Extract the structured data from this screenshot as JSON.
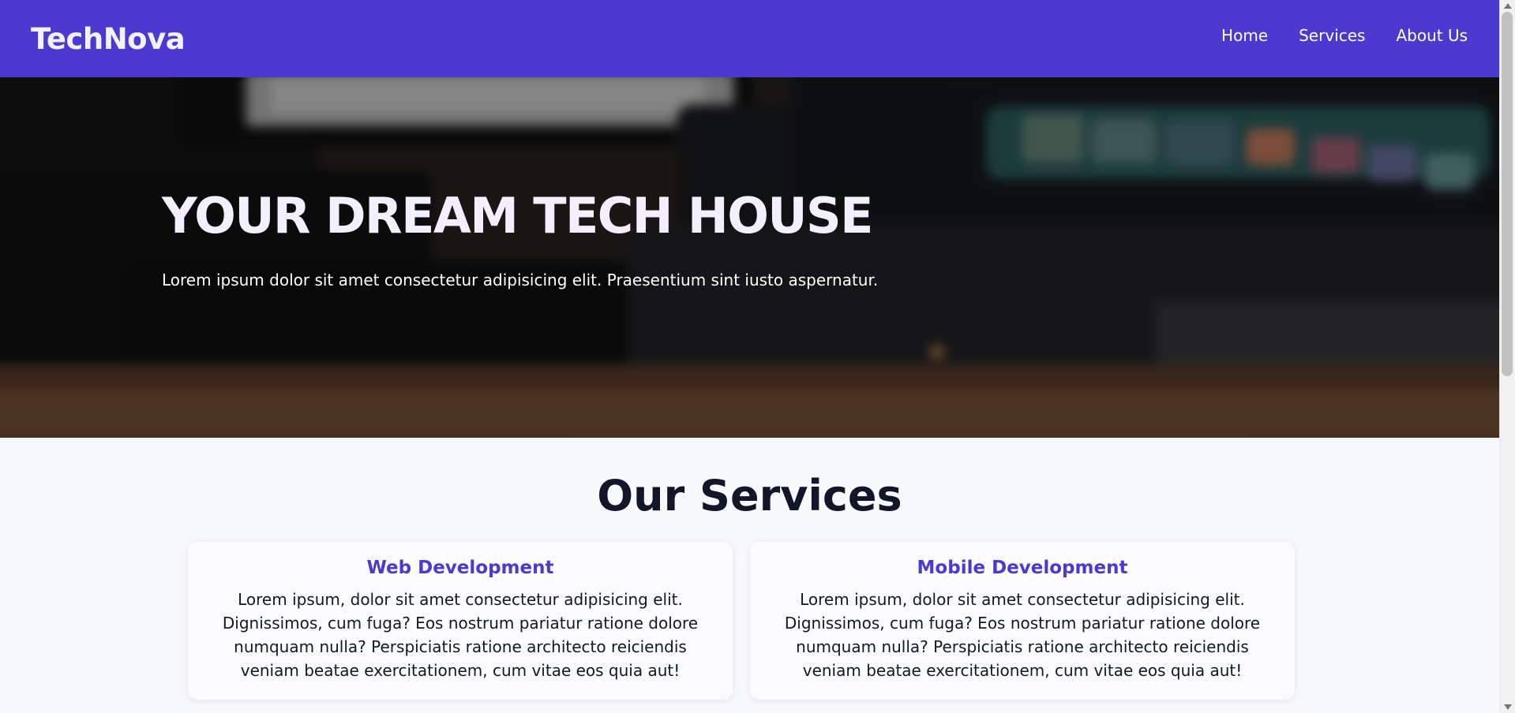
{
  "header": {
    "brand": "TechNova",
    "nav": [
      "Home",
      "Services",
      "About Us"
    ]
  },
  "hero": {
    "title": "YOUR DREAM TECH HOUSE",
    "subtitle": "Lorem ipsum dolor sit amet consectetur adipisicing elit. Praesentium sint iusto aspernatur."
  },
  "services": {
    "title": "Our Services",
    "cards": [
      {
        "title": "Web Development",
        "text": "Lorem ipsum, dolor sit amet consectetur adipisicing elit. Dignissimos, cum fuga? Eos nostrum pariatur ratione dolore numquam nulla? Perspiciatis ratione architecto reiciendis veniam beatae exercitationem, cum vitae eos quia aut!"
      },
      {
        "title": "Mobile Development",
        "text": "Lorem ipsum, dolor sit amet consectetur adipisicing elit. Dignissimos, cum fuga? Eos nostrum pariatur ratione dolore numquam nulla? Perspiciatis ratione architecto reiciendis veniam beatae exercitationem, cum vitae eos quia aut!"
      }
    ]
  },
  "theme": {
    "primary": "#4b3acf",
    "background": "#f8f9fc",
    "dark_text": "#121629",
    "hero_text": "#f4efff"
  },
  "scroll": {
    "position_fraction": 0
  }
}
